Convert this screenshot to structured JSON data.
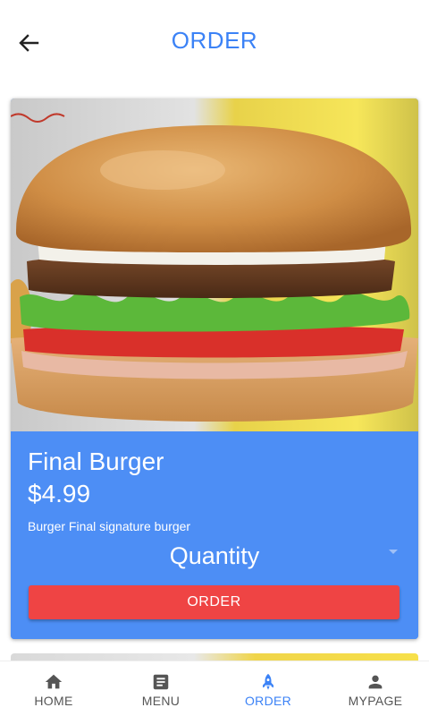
{
  "header": {
    "title": "ORDER"
  },
  "product": {
    "name": "Final Burger",
    "price": "$4.99",
    "description": "Burger Final signature burger",
    "quantity_label": "Quantity",
    "order_label": "ORDER"
  },
  "nav": {
    "items": [
      {
        "label": "HOME",
        "icon": "home-icon"
      },
      {
        "label": "MENU",
        "icon": "menu-list-icon"
      },
      {
        "label": "ORDER",
        "icon": "rocket-icon"
      },
      {
        "label": "MYPAGE",
        "icon": "person-icon"
      }
    ],
    "active": "ORDER"
  },
  "colors": {
    "accent": "#3b82f6",
    "card": "#4d8ef5",
    "order_button": "#ef4444"
  }
}
